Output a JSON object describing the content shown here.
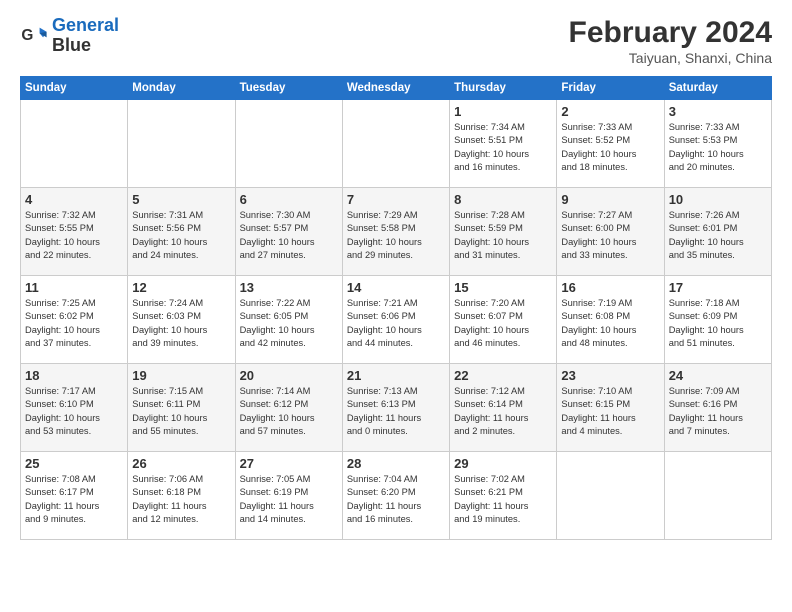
{
  "logo": {
    "line1": "General",
    "line2": "Blue"
  },
  "header": {
    "title": "February 2024",
    "subtitle": "Taiyuan, Shanxi, China"
  },
  "weekdays": [
    "Sunday",
    "Monday",
    "Tuesday",
    "Wednesday",
    "Thursday",
    "Friday",
    "Saturday"
  ],
  "weeks": [
    [
      {
        "day": "",
        "data": ""
      },
      {
        "day": "",
        "data": ""
      },
      {
        "day": "",
        "data": ""
      },
      {
        "day": "",
        "data": ""
      },
      {
        "day": "1",
        "data": "Sunrise: 7:34 AM\nSunset: 5:51 PM\nDaylight: 10 hours\nand 16 minutes."
      },
      {
        "day": "2",
        "data": "Sunrise: 7:33 AM\nSunset: 5:52 PM\nDaylight: 10 hours\nand 18 minutes."
      },
      {
        "day": "3",
        "data": "Sunrise: 7:33 AM\nSunset: 5:53 PM\nDaylight: 10 hours\nand 20 minutes."
      }
    ],
    [
      {
        "day": "4",
        "data": "Sunrise: 7:32 AM\nSunset: 5:55 PM\nDaylight: 10 hours\nand 22 minutes."
      },
      {
        "day": "5",
        "data": "Sunrise: 7:31 AM\nSunset: 5:56 PM\nDaylight: 10 hours\nand 24 minutes."
      },
      {
        "day": "6",
        "data": "Sunrise: 7:30 AM\nSunset: 5:57 PM\nDaylight: 10 hours\nand 27 minutes."
      },
      {
        "day": "7",
        "data": "Sunrise: 7:29 AM\nSunset: 5:58 PM\nDaylight: 10 hours\nand 29 minutes."
      },
      {
        "day": "8",
        "data": "Sunrise: 7:28 AM\nSunset: 5:59 PM\nDaylight: 10 hours\nand 31 minutes."
      },
      {
        "day": "9",
        "data": "Sunrise: 7:27 AM\nSunset: 6:00 PM\nDaylight: 10 hours\nand 33 minutes."
      },
      {
        "day": "10",
        "data": "Sunrise: 7:26 AM\nSunset: 6:01 PM\nDaylight: 10 hours\nand 35 minutes."
      }
    ],
    [
      {
        "day": "11",
        "data": "Sunrise: 7:25 AM\nSunset: 6:02 PM\nDaylight: 10 hours\nand 37 minutes."
      },
      {
        "day": "12",
        "data": "Sunrise: 7:24 AM\nSunset: 6:03 PM\nDaylight: 10 hours\nand 39 minutes."
      },
      {
        "day": "13",
        "data": "Sunrise: 7:22 AM\nSunset: 6:05 PM\nDaylight: 10 hours\nand 42 minutes."
      },
      {
        "day": "14",
        "data": "Sunrise: 7:21 AM\nSunset: 6:06 PM\nDaylight: 10 hours\nand 44 minutes."
      },
      {
        "day": "15",
        "data": "Sunrise: 7:20 AM\nSunset: 6:07 PM\nDaylight: 10 hours\nand 46 minutes."
      },
      {
        "day": "16",
        "data": "Sunrise: 7:19 AM\nSunset: 6:08 PM\nDaylight: 10 hours\nand 48 minutes."
      },
      {
        "day": "17",
        "data": "Sunrise: 7:18 AM\nSunset: 6:09 PM\nDaylight: 10 hours\nand 51 minutes."
      }
    ],
    [
      {
        "day": "18",
        "data": "Sunrise: 7:17 AM\nSunset: 6:10 PM\nDaylight: 10 hours\nand 53 minutes."
      },
      {
        "day": "19",
        "data": "Sunrise: 7:15 AM\nSunset: 6:11 PM\nDaylight: 10 hours\nand 55 minutes."
      },
      {
        "day": "20",
        "data": "Sunrise: 7:14 AM\nSunset: 6:12 PM\nDaylight: 10 hours\nand 57 minutes."
      },
      {
        "day": "21",
        "data": "Sunrise: 7:13 AM\nSunset: 6:13 PM\nDaylight: 11 hours\nand 0 minutes."
      },
      {
        "day": "22",
        "data": "Sunrise: 7:12 AM\nSunset: 6:14 PM\nDaylight: 11 hours\nand 2 minutes."
      },
      {
        "day": "23",
        "data": "Sunrise: 7:10 AM\nSunset: 6:15 PM\nDaylight: 11 hours\nand 4 minutes."
      },
      {
        "day": "24",
        "data": "Sunrise: 7:09 AM\nSunset: 6:16 PM\nDaylight: 11 hours\nand 7 minutes."
      }
    ],
    [
      {
        "day": "25",
        "data": "Sunrise: 7:08 AM\nSunset: 6:17 PM\nDaylight: 11 hours\nand 9 minutes."
      },
      {
        "day": "26",
        "data": "Sunrise: 7:06 AM\nSunset: 6:18 PM\nDaylight: 11 hours\nand 12 minutes."
      },
      {
        "day": "27",
        "data": "Sunrise: 7:05 AM\nSunset: 6:19 PM\nDaylight: 11 hours\nand 14 minutes."
      },
      {
        "day": "28",
        "data": "Sunrise: 7:04 AM\nSunset: 6:20 PM\nDaylight: 11 hours\nand 16 minutes."
      },
      {
        "day": "29",
        "data": "Sunrise: 7:02 AM\nSunset: 6:21 PM\nDaylight: 11 hours\nand 19 minutes."
      },
      {
        "day": "",
        "data": ""
      },
      {
        "day": "",
        "data": ""
      }
    ]
  ]
}
